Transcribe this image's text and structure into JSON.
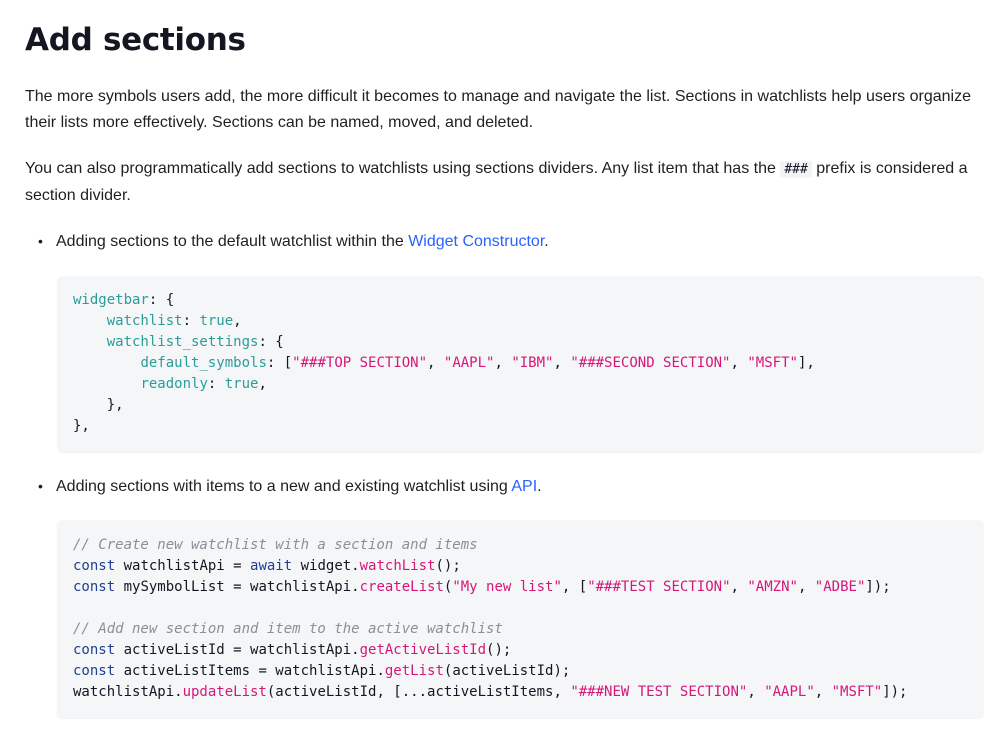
{
  "title": "Add sections",
  "para1": "The more symbols users add, the more difficult it becomes to manage and navigate the list. Sections in watchlists help users organize their lists more effectively. Sections can be named, moved, and deleted.",
  "para2": {
    "before": "You can also programmatically add sections to watchlists using sections dividers. Any list item that has the ",
    "code": "###",
    "after": " prefix is considered a section divider."
  },
  "bullet1": {
    "text": "Adding sections to the default watchlist within the ",
    "link": "Widget Constructor",
    "end": "."
  },
  "bullet2": {
    "text": "Adding sections with items to a new and existing watchlist using ",
    "link": "API",
    "end": "."
  },
  "code1": {
    "l1": {
      "prop": "widgetbar",
      "rest": ": {"
    },
    "l2": {
      "indent": "    ",
      "prop": "watchlist",
      "colon": ": ",
      "val": "true",
      "end": ","
    },
    "l3": {
      "indent": "    ",
      "prop": "watchlist_settings",
      "rest": ": {"
    },
    "l4": {
      "indent": "        ",
      "prop": "default_symbols",
      "colon": ": [",
      "s1": "\"###TOP SECTION\"",
      "s2": "\"AAPL\"",
      "s3": "\"IBM\"",
      "s4": "\"###SECOND SECTION\"",
      "s5": "\"MSFT\"",
      "sep": ", ",
      "end": "],"
    },
    "l5": {
      "indent": "        ",
      "prop": "readonly",
      "colon": ": ",
      "val": "true",
      "end": ","
    },
    "l6": "    },",
    "l7": "},"
  },
  "code2": {
    "c1": "// Create new watchlist with a section and items",
    "l1": {
      "kw": "const",
      "a": " watchlistApi = ",
      "kw2": "await",
      "b": " widget.",
      "fn": "watchList",
      "c": "();"
    },
    "l2": {
      "kw": "const",
      "a": " mySymbolList = watchlistApi.",
      "fn": "createList",
      "b": "(",
      "s1": "\"My new list\"",
      "c": ", [",
      "s2": "\"###TEST SECTION\"",
      "sep": ", ",
      "s3": "\"AMZN\"",
      "s4": "\"ADBE\"",
      "end": "]);"
    },
    "c2": "// Add new section and item to the active watchlist",
    "l3": {
      "kw": "const",
      "a": " activeListId = watchlistApi.",
      "fn": "getActiveListId",
      "b": "();"
    },
    "l4": {
      "kw": "const",
      "a": " activeListItems = watchlistApi.",
      "fn": "getList",
      "b": "(activeListId);"
    },
    "l5": {
      "a": "watchlistApi.",
      "fn": "updateList",
      "b": "(activeListId, [...activeListItems, ",
      "s1": "\"###NEW TEST SECTION\"",
      "sep": ", ",
      "s2": "\"AAPL\"",
      "s3": "\"MSFT\"",
      "end": "]);"
    }
  },
  "colors": {
    "link": "#2962ff",
    "property": "#2a9d9a",
    "string": "#d6177a",
    "keyword": "#1f3f8f",
    "comment": "#8a8f98",
    "code_background": "#f5f6f8"
  }
}
